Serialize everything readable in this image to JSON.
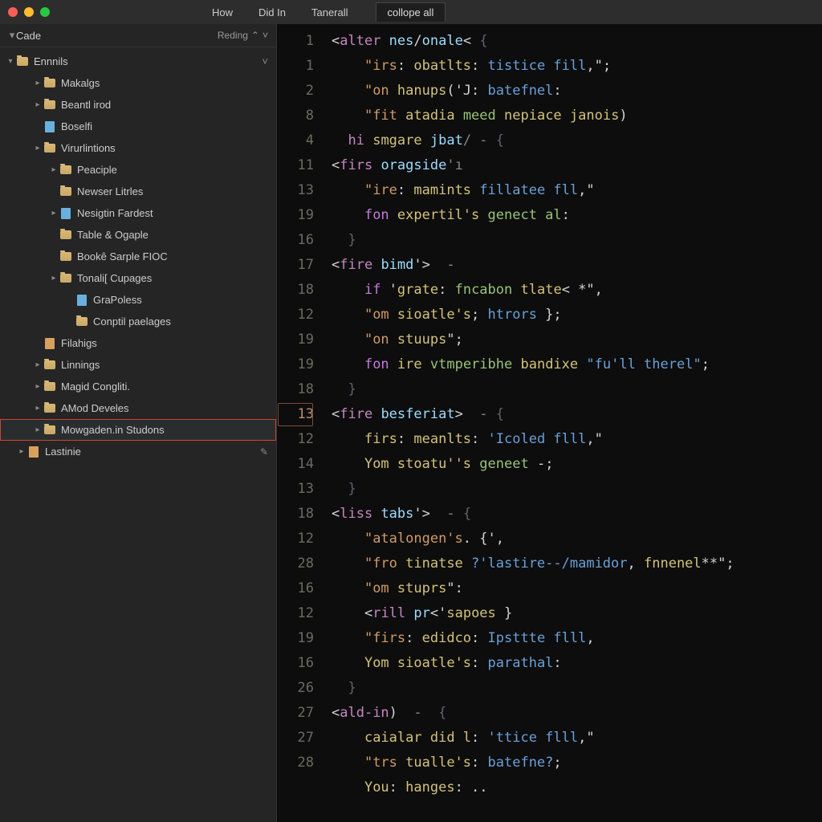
{
  "menu": {
    "items": [
      "How",
      "Did In",
      "Tanerall"
    ]
  },
  "tabs": {
    "items": [
      "collope all"
    ],
    "activeIndex": 0
  },
  "sidebar": {
    "title": "Cade",
    "control": "Reding",
    "root": {
      "label": "Ennnils"
    },
    "tree": [
      {
        "depth": 1,
        "twisty": "▸",
        "icon": "folder",
        "label": "Makalgs"
      },
      {
        "depth": 1,
        "twisty": "▸",
        "icon": "folder",
        "label": "Beantl irod"
      },
      {
        "depth": 1,
        "twisty": "",
        "icon": "file-blue",
        "label": "Boselfi"
      },
      {
        "depth": 1,
        "twisty": "▸",
        "icon": "folder",
        "label": "Virurlintions"
      },
      {
        "depth": 2,
        "twisty": "▸",
        "icon": "folder",
        "label": "Peaciple"
      },
      {
        "depth": 2,
        "twisty": "",
        "icon": "folder",
        "label": "Newser Litrles"
      },
      {
        "depth": 2,
        "twisty": "▸",
        "icon": "file-blue",
        "label": "Nesigtin Fardest"
      },
      {
        "depth": 2,
        "twisty": "",
        "icon": "folder",
        "label": "Table & Ogaple"
      },
      {
        "depth": 2,
        "twisty": "",
        "icon": "folder",
        "label": "Bookê Sarple FIOC"
      },
      {
        "depth": 2,
        "twisty": "▸",
        "icon": "folder",
        "label": "Tonali[ Cupages"
      },
      {
        "depth": 3,
        "twisty": "",
        "icon": "file-blue",
        "label": "GraPoless"
      },
      {
        "depth": 3,
        "twisty": "",
        "icon": "folder",
        "label": "Conptil paelages"
      },
      {
        "depth": 1,
        "twisty": "",
        "icon": "file-orange",
        "label": "Filahigs"
      },
      {
        "depth": 1,
        "twisty": "▸",
        "icon": "folder",
        "label": "Linnings"
      },
      {
        "depth": 1,
        "twisty": "▸",
        "icon": "folder",
        "label": "Magid Congliti."
      },
      {
        "depth": 1,
        "twisty": "▸",
        "icon": "folder",
        "label": "AMod Develes"
      },
      {
        "depth": 1,
        "twisty": "▸",
        "icon": "folder",
        "label": "Mowgaden.in Studons",
        "selected": true
      },
      {
        "depth": 0,
        "twisty": "▸",
        "icon": "file-orange",
        "label": "Lastinie",
        "edit": true
      }
    ]
  },
  "editor": {
    "gutter": [
      "1",
      "1",
      "2",
      "8",
      "4",
      "11",
      "13",
      "19",
      "16",
      "17",
      "18",
      "12",
      "19",
      "19",
      "18",
      "13",
      "12",
      "14",
      "13",
      "18",
      "12",
      "28",
      "16",
      "12",
      "19",
      "16",
      "26",
      "27",
      "27",
      "28",
      ""
    ],
    "gutterBoxIndex": 15,
    "lines": [
      [
        [
          "tk-pun",
          "<"
        ],
        [
          "tk-tag",
          "alter "
        ],
        [
          "tk-attr",
          "nes"
        ],
        [
          "tk-pun",
          "/"
        ],
        [
          "tk-attr",
          "onale"
        ],
        [
          "tk-pun",
          "< "
        ],
        [
          "tk-dim",
          "{"
        ]
      ],
      [
        [
          "pad",
          "    "
        ],
        [
          "tk-key",
          "\"irs"
        ],
        [
          "tk-pun",
          ": "
        ],
        [
          "tk-id",
          "obatlts"
        ],
        [
          "tk-pun",
          ": "
        ],
        [
          "tk-str",
          "tistice fill"
        ],
        [
          "tk-pun",
          ",\";"
        ]
      ],
      [
        [
          "pad",
          "    "
        ],
        [
          "tk-key",
          "\"on "
        ],
        [
          "tk-id",
          "hanups"
        ],
        [
          "tk-pun",
          "('J: "
        ],
        [
          "tk-str",
          "batefnel"
        ],
        [
          "tk-pun",
          ":"
        ]
      ],
      [
        [
          "pad",
          "    "
        ],
        [
          "tk-key",
          "\"fit "
        ],
        [
          "tk-id",
          "atadia"
        ],
        [
          "tk-pun",
          " "
        ],
        [
          "tk-str2",
          "meed"
        ],
        [
          "tk-pun",
          " "
        ],
        [
          "tk-id",
          "nepiace"
        ],
        [
          "tk-pun",
          " "
        ],
        [
          "tk-id",
          "janois"
        ],
        [
          "tk-pun",
          ")"
        ]
      ],
      [
        [
          "pad",
          "  "
        ],
        [
          "tk-tag",
          "hi "
        ],
        [
          "tk-id",
          "smgare"
        ],
        [
          "tk-pun",
          " "
        ],
        [
          "tk-attr",
          "jbat"
        ],
        [
          "tk-op",
          "/ - "
        ],
        [
          "tk-dim",
          "{"
        ]
      ],
      [
        [
          "tk-pun",
          "<"
        ],
        [
          "tk-tag",
          "firs "
        ],
        [
          "tk-attr",
          "oragside"
        ],
        [
          "tk-op",
          "'ı"
        ]
      ],
      [
        [
          "pad",
          "    "
        ],
        [
          "tk-key",
          "\"ire"
        ],
        [
          "tk-pun",
          ": "
        ],
        [
          "tk-id",
          "mamints"
        ],
        [
          "tk-pun",
          " "
        ],
        [
          "tk-str",
          "fillatee fll"
        ],
        [
          "tk-pun",
          ",\""
        ]
      ],
      [
        [
          "pad",
          "    "
        ],
        [
          "tk-kw",
          "fon "
        ],
        [
          "tk-id",
          "expertil's"
        ],
        [
          "tk-pun",
          " "
        ],
        [
          "tk-str2",
          "genect al"
        ],
        [
          "tk-pun",
          ":"
        ]
      ],
      [
        [
          "pad",
          "  "
        ],
        [
          "tk-dim",
          "}"
        ]
      ],
      [
        [
          "tk-pun",
          "<"
        ],
        [
          "tk-tag",
          "fire "
        ],
        [
          "tk-attr",
          "bimd"
        ],
        [
          "tk-pun",
          "'>"
        ],
        [
          "tk-op",
          "  -"
        ]
      ],
      [
        [
          "pad",
          "    "
        ],
        [
          "tk-kw",
          "if"
        ],
        [
          "tk-pun",
          " '"
        ],
        [
          "tk-id",
          "grate"
        ],
        [
          "tk-pun",
          ": "
        ],
        [
          "tk-str2",
          "fncabon"
        ],
        [
          "tk-pun",
          " "
        ],
        [
          "tk-id",
          "tlate"
        ],
        [
          "tk-pun",
          "< *\","
        ]
      ],
      [
        [
          "pad",
          "    "
        ],
        [
          "tk-key",
          "\"om "
        ],
        [
          "tk-id",
          "sioatle's"
        ],
        [
          "tk-pun",
          "; "
        ],
        [
          "tk-str",
          "htrors"
        ],
        [
          "tk-pun",
          " };"
        ]
      ],
      [
        [
          "pad",
          "    "
        ],
        [
          "tk-key",
          "\"on "
        ],
        [
          "tk-id",
          "stuups"
        ],
        [
          "tk-pun",
          "\";"
        ]
      ],
      [
        [
          "pad",
          "    "
        ],
        [
          "tk-kw",
          "fon "
        ],
        [
          "tk-id",
          "ire"
        ],
        [
          "tk-pun",
          " "
        ],
        [
          "tk-str2",
          "vtmperibhe"
        ],
        [
          "tk-pun",
          " "
        ],
        [
          "tk-id",
          "bandixe"
        ],
        [
          "tk-pun",
          " "
        ],
        [
          "tk-str",
          "\"fu'll therel\""
        ],
        [
          "tk-pun",
          ";"
        ]
      ],
      [
        [
          "pad",
          "  "
        ],
        [
          "tk-dim",
          "}"
        ]
      ],
      [
        [
          "tk-pun",
          "<"
        ],
        [
          "tk-tag",
          "fire "
        ],
        [
          "tk-attr",
          "besferiat"
        ],
        [
          "tk-pun",
          ">"
        ],
        [
          "tk-op",
          "  - "
        ],
        [
          "tk-dim",
          "{"
        ]
      ],
      [
        [
          "pad",
          "    "
        ],
        [
          "tk-id",
          "firs"
        ],
        [
          "tk-pun",
          ": "
        ],
        [
          "tk-id",
          "meanlts"
        ],
        [
          "tk-pun",
          ": "
        ],
        [
          "tk-str",
          "'Icoled flll"
        ],
        [
          "tk-pun",
          ",\""
        ]
      ],
      [
        [
          "pad",
          "    "
        ],
        [
          "tk-id",
          "Yom"
        ],
        [
          "tk-pun",
          " "
        ],
        [
          "tk-id",
          "stoatu''s"
        ],
        [
          "tk-pun",
          " "
        ],
        [
          "tk-str2",
          "geneet"
        ],
        [
          "tk-pun",
          " -;"
        ]
      ],
      [
        [
          "pad",
          "  "
        ],
        [
          "tk-dim",
          "}"
        ]
      ],
      [
        [
          "tk-pun",
          "<"
        ],
        [
          "tk-tag",
          "liss "
        ],
        [
          "tk-attr",
          "tabs"
        ],
        [
          "tk-pun",
          "'>"
        ],
        [
          "tk-op",
          "  - "
        ],
        [
          "tk-dim",
          "{"
        ]
      ],
      [
        [
          "pad",
          "    "
        ],
        [
          "tk-key",
          "\"atalongen's"
        ],
        [
          "tk-pun",
          ". {',"
        ]
      ],
      [
        [
          "pad",
          "    "
        ],
        [
          "tk-key",
          "\"fro "
        ],
        [
          "tk-id",
          "tinatse"
        ],
        [
          "tk-pun",
          " "
        ],
        [
          "tk-str",
          "?'lastire--/mamidor"
        ],
        [
          "tk-pun",
          ", "
        ],
        [
          "tk-id",
          "fnnenel"
        ],
        [
          "tk-pun",
          "**\";"
        ]
      ],
      [
        [
          "pad",
          "    "
        ],
        [
          "tk-key",
          "\"om "
        ],
        [
          "tk-id",
          "stuprs"
        ],
        [
          "tk-pun",
          "\":"
        ]
      ],
      [
        [
          "pad",
          "    "
        ],
        [
          "tk-pun",
          "<"
        ],
        [
          "tk-tag",
          "rill "
        ],
        [
          "tk-attr",
          "pr"
        ],
        [
          "tk-pun",
          "<'"
        ],
        [
          "tk-id",
          "sapoes"
        ],
        [
          "tk-pun",
          " }"
        ]
      ],
      [
        [
          "pad",
          "    "
        ],
        [
          "tk-key",
          "\"firs"
        ],
        [
          "tk-pun",
          ": "
        ],
        [
          "tk-id",
          "edidco"
        ],
        [
          "tk-pun",
          ": "
        ],
        [
          "tk-str",
          "Ipsttte flll"
        ],
        [
          "tk-pun",
          ","
        ]
      ],
      [
        [
          "pad",
          "    "
        ],
        [
          "tk-id",
          "Yom"
        ],
        [
          "tk-pun",
          " "
        ],
        [
          "tk-id",
          "sioatle's"
        ],
        [
          "tk-pun",
          ": "
        ],
        [
          "tk-str",
          "parathal"
        ],
        [
          "tk-pun",
          ":"
        ]
      ],
      [
        [
          "pad",
          "  "
        ],
        [
          "tk-dim",
          "}"
        ]
      ],
      [
        [
          "tk-pun",
          "<"
        ],
        [
          "tk-tag",
          "ald-in"
        ],
        [
          "tk-pun",
          ")  "
        ],
        [
          "tk-op",
          "- "
        ],
        [
          "tk-dim",
          " {"
        ]
      ],
      [
        [
          "pad",
          "    "
        ],
        [
          "tk-id",
          "caialar"
        ],
        [
          "tk-pun",
          " "
        ],
        [
          "tk-id",
          "did l"
        ],
        [
          "tk-pun",
          ": "
        ],
        [
          "tk-str",
          "'ttice flll"
        ],
        [
          "tk-pun",
          ",\""
        ]
      ],
      [
        [
          "pad",
          "    "
        ],
        [
          "tk-key",
          "\"trs "
        ],
        [
          "tk-id",
          "tualle's"
        ],
        [
          "tk-pun",
          ": "
        ],
        [
          "tk-str",
          "batefne?"
        ],
        [
          "tk-pun",
          ";"
        ]
      ],
      [
        [
          "pad",
          "    "
        ],
        [
          "tk-id",
          "You"
        ],
        [
          "tk-pun",
          ": "
        ],
        [
          "tk-id",
          "hanges"
        ],
        [
          "tk-pun",
          ": .."
        ]
      ]
    ]
  }
}
